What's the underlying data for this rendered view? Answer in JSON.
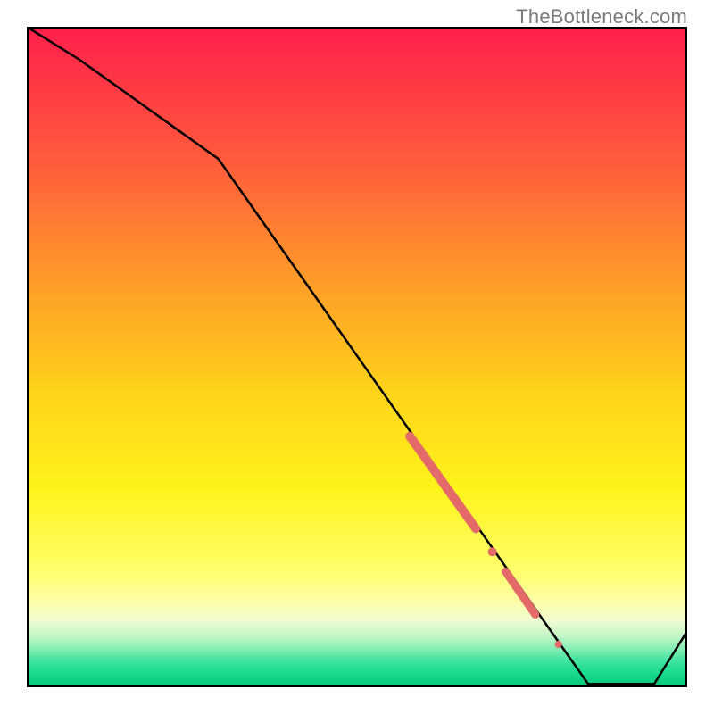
{
  "watermark": "TheBottleneck.com",
  "chart_data": {
    "type": "line",
    "title": "",
    "xlabel": "",
    "ylabel": "",
    "xlim": [
      0,
      100
    ],
    "ylim": [
      0,
      100
    ],
    "grid": false,
    "legend": false,
    "series": [
      {
        "name": "curve",
        "x": [
          0,
          8,
          29,
          85,
          95,
          100
        ],
        "y": [
          100,
          95,
          80,
          0.5,
          0.5,
          8.5
        ]
      }
    ],
    "highlights": [
      {
        "type": "thick-segment",
        "x0": 58,
        "y0": 38,
        "x1": 68,
        "y1": 24,
        "width": 10
      },
      {
        "type": "dot",
        "x": 70.5,
        "y": 20.5,
        "r": 5
      },
      {
        "type": "thick-segment",
        "x0": 72.5,
        "y0": 17.5,
        "x1": 77,
        "y1": 11,
        "width": 9
      },
      {
        "type": "dot",
        "x": 80.5,
        "y": 6.5,
        "r": 4
      }
    ],
    "gradient_bands_pct_from_top": [
      {
        "stop": 0,
        "color": "#ff1f4b"
      },
      {
        "stop": 20,
        "color": "#ff5a3c"
      },
      {
        "stop": 38,
        "color": "#ff9a2a"
      },
      {
        "stop": 55,
        "color": "#ffd21a"
      },
      {
        "stop": 70,
        "color": "#fff31a"
      },
      {
        "stop": 83,
        "color": "#ffff70"
      },
      {
        "stop": 87,
        "color": "#fffca8"
      },
      {
        "stop": 90,
        "color": "#eefcd0"
      },
      {
        "stop": 92,
        "color": "#c9f7c9"
      },
      {
        "stop": 94,
        "color": "#8ceeb6"
      },
      {
        "stop": 96,
        "color": "#3fe49e"
      },
      {
        "stop": 98,
        "color": "#17d98b"
      },
      {
        "stop": 100,
        "color": "#08c97a"
      }
    ],
    "highlight_color": "#e46a6a",
    "line_color": "#000000"
  }
}
